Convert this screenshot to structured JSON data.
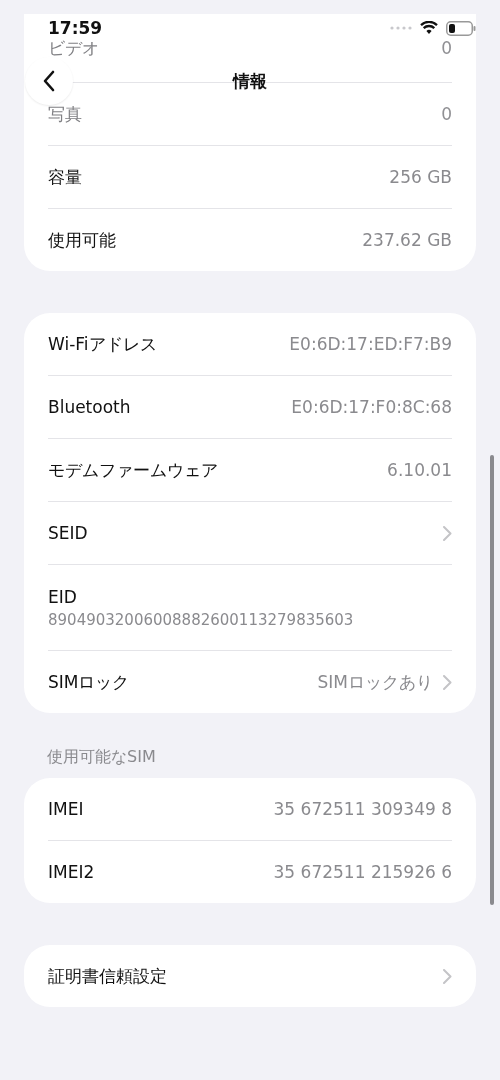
{
  "status_bar": {
    "time": "17:59"
  },
  "nav": {
    "title": "情報"
  },
  "groups": [
    {
      "rows": [
        {
          "kind": "detail",
          "label": "ビデオ",
          "value": "0",
          "chevron": false,
          "faded": true
        },
        {
          "kind": "detail",
          "label": "写真",
          "value": "0",
          "chevron": false,
          "faded": true
        },
        {
          "kind": "detail",
          "label": "容量",
          "value": "256 GB",
          "chevron": false,
          "faded": false
        },
        {
          "kind": "detail",
          "label": "使用可能",
          "value": "237.62 GB",
          "chevron": false,
          "faded": false
        }
      ]
    },
    {
      "rows": [
        {
          "kind": "detail",
          "label": "Wi-Fiアドレス",
          "value": "E0:6D:17:ED:F7:B9",
          "chevron": false,
          "faded": false
        },
        {
          "kind": "detail",
          "label": "Bluetooth",
          "value": "E0:6D:17:F0:8C:68",
          "chevron": false,
          "faded": false
        },
        {
          "kind": "detail",
          "label": "モデムファームウェア",
          "value": "6.10.01",
          "chevron": false,
          "faded": false
        },
        {
          "kind": "detail",
          "label": "SEID",
          "chevron": true,
          "faded": false
        },
        {
          "kind": "stacked",
          "label": "EID",
          "value": "89049032006008882600113279835603",
          "faded": false
        },
        {
          "kind": "detail",
          "label": "SIMロック",
          "value": "SIMロックあり",
          "chevron": true,
          "faded": false
        }
      ]
    },
    {
      "header": "使用可能なSIM",
      "rows": [
        {
          "kind": "detail",
          "label": "IMEI",
          "value": "35 672511 309349 8",
          "chevron": false,
          "faded": false
        },
        {
          "kind": "detail",
          "label": "IMEI2",
          "value": "35 672511 215926 6",
          "chevron": false,
          "faded": false
        }
      ]
    },
    {
      "rows": [
        {
          "kind": "detail",
          "label": "証明書信頼設定",
          "chevron": true,
          "faded": false
        }
      ]
    }
  ]
}
